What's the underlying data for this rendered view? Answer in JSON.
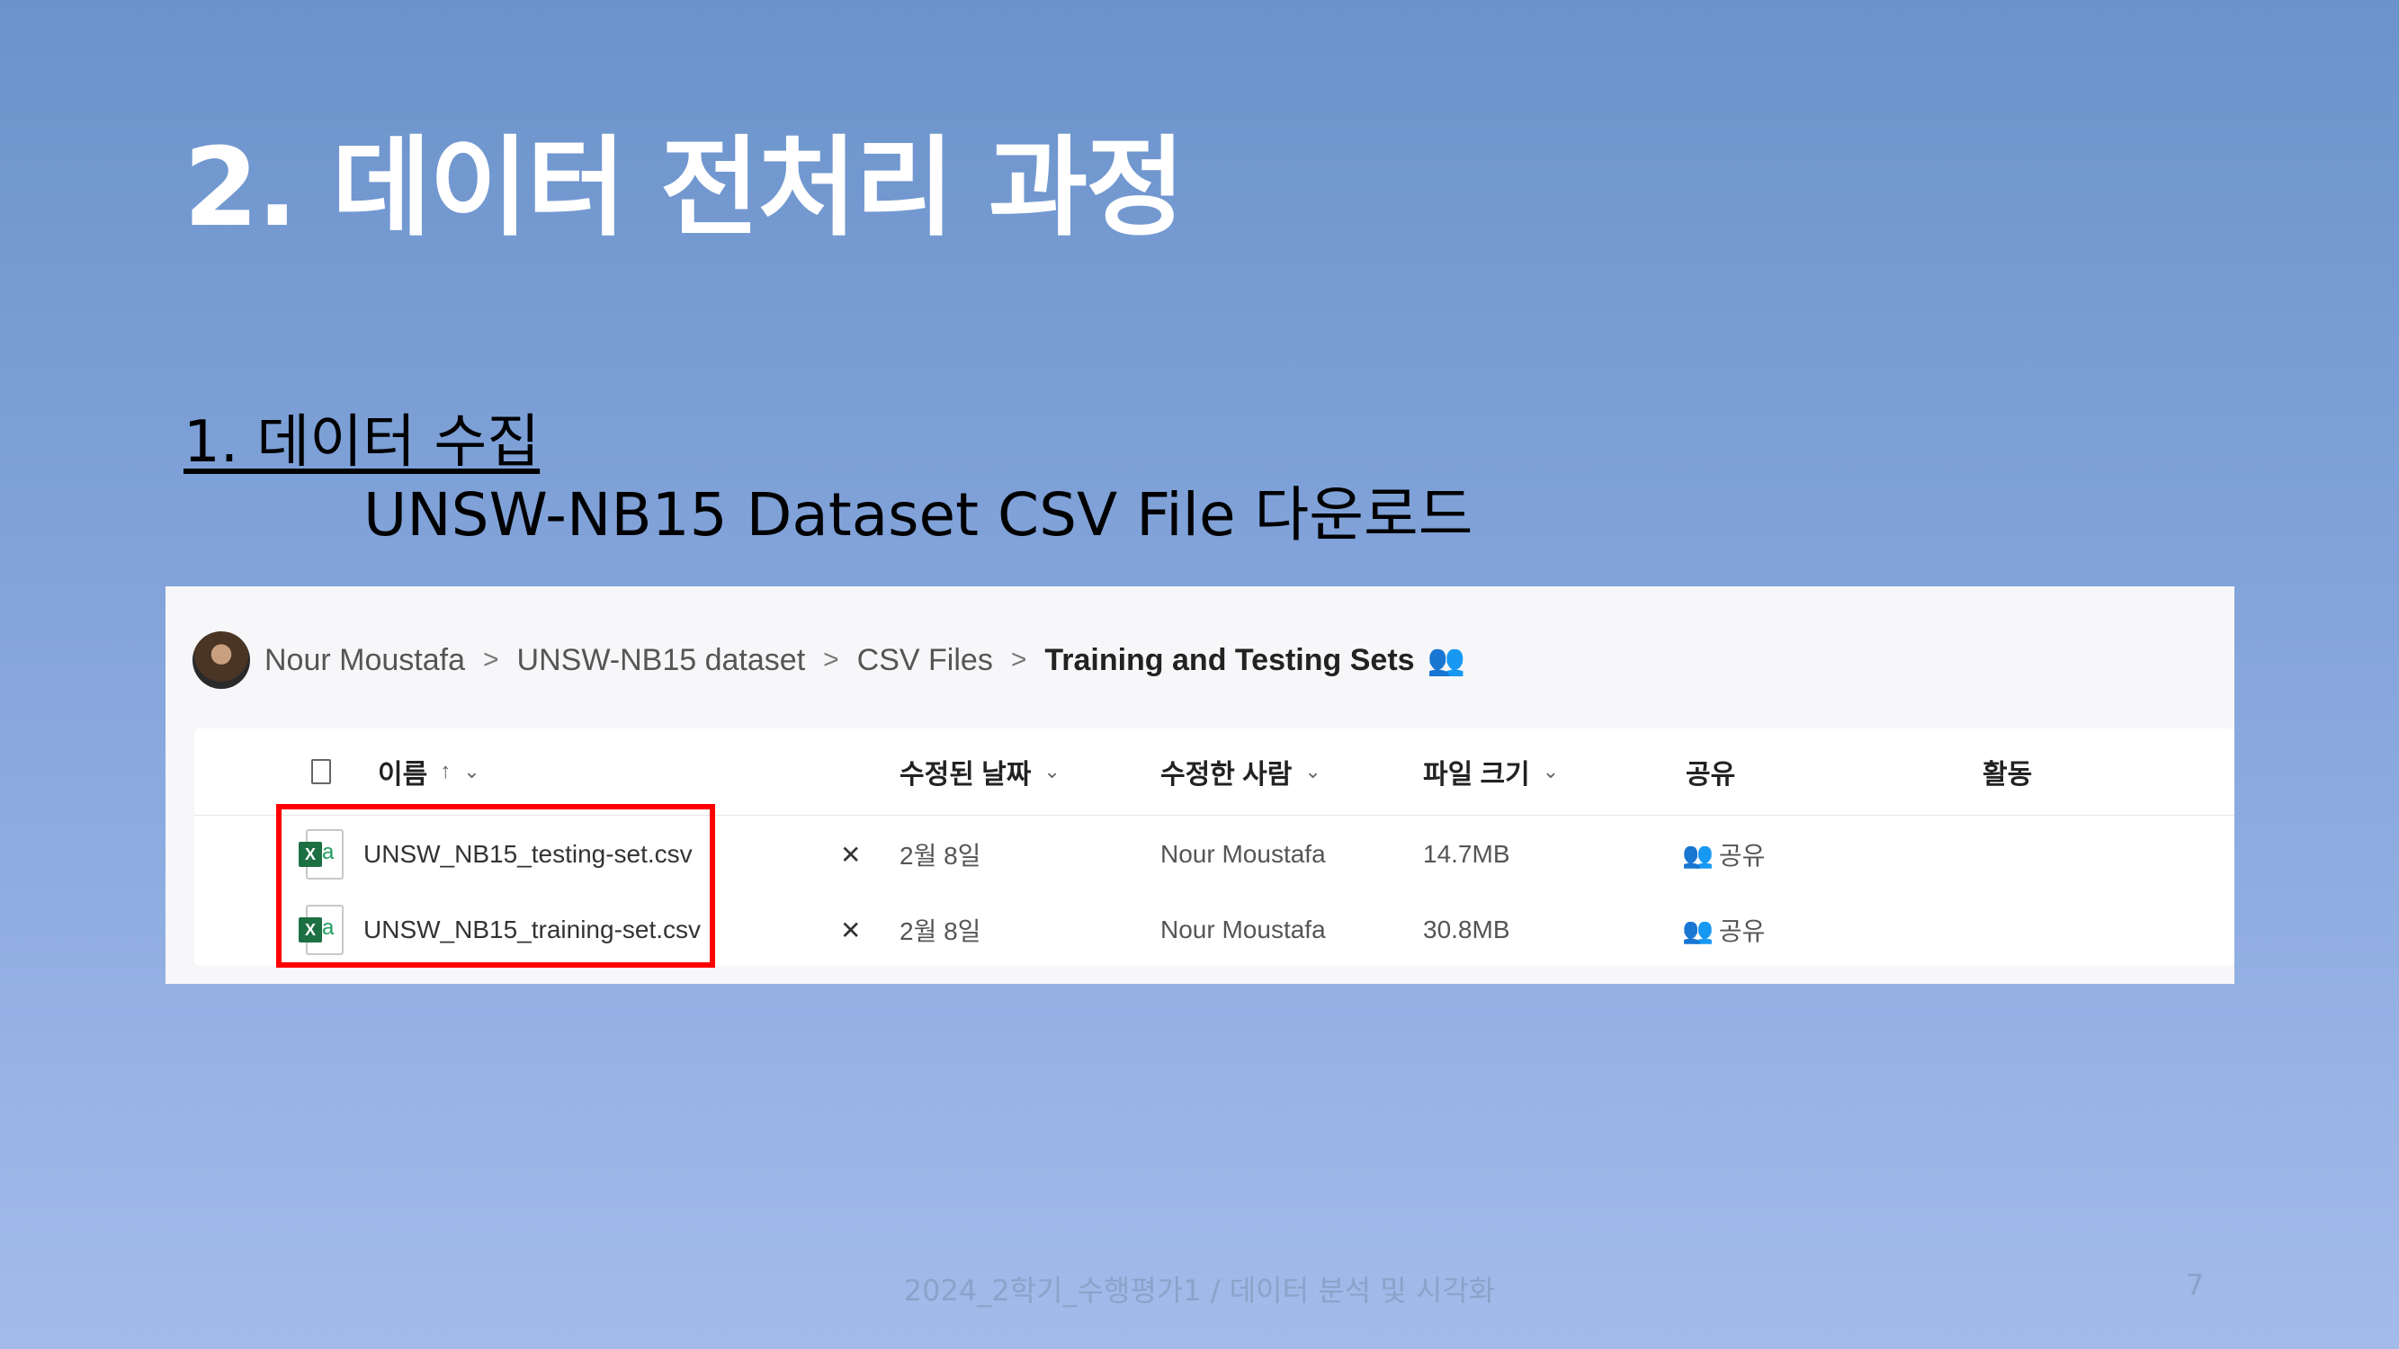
{
  "slide": {
    "title": "2. 데이터 전처리 과정",
    "section_heading": "1. 데이터 수집",
    "section_sub": "UNSW-NB15 Dataset CSV File 다운로드",
    "footer": "2024_2학기_수행평가1 / 데이터 분석 및 시각화",
    "page_number": "7"
  },
  "explorer": {
    "breadcrumb": [
      "Nour Moustafa",
      "UNSW-NB15 dataset",
      "CSV Files",
      "Training and Testing Sets"
    ],
    "separator": ">",
    "shared_glyph": "👥",
    "columns": {
      "name": "이름",
      "modified": "수정된 날짜",
      "modified_by": "수정한 사람",
      "size": "파일 크기",
      "sharing": "공유",
      "activity": "활동"
    },
    "sort_arrow": "↑",
    "caret": "⌄",
    "files": [
      {
        "name": "UNSW_NB15_testing-set.csv",
        "modified": "2월 8일",
        "modified_by": "Nour Moustafa",
        "size": "14.7MB",
        "sharing": "공유"
      },
      {
        "name": "UNSW_NB15_training-set.csv",
        "modified": "2월 8일",
        "modified_by": "Nour Moustafa",
        "size": "30.8MB",
        "sharing": "공유"
      }
    ],
    "excel_glyph_x": "X",
    "excel_glyph_a": "a",
    "pin_glyph": "✕",
    "share_prefix_glyph": "👥"
  }
}
